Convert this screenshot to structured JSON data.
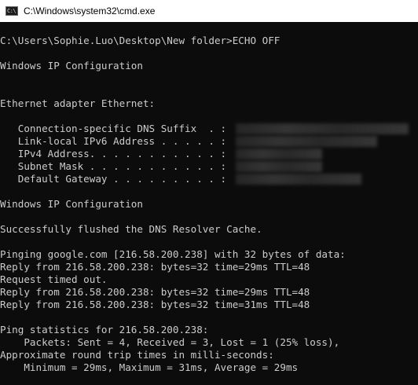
{
  "window": {
    "title": "C:\\Windows\\system32\\cmd.exe",
    "icon": "cmd-icon",
    "icon_text": "C:\\"
  },
  "console": {
    "lines": [
      {
        "text": "C:\\Users\\Sophie.Luo\\Desktop\\New folder>ECHO OFF"
      },
      {
        "text": ""
      },
      {
        "text": "Windows IP Configuration"
      },
      {
        "text": ""
      },
      {
        "text": ""
      },
      {
        "text": "Ethernet adapter Ethernet:"
      },
      {
        "text": ""
      },
      {
        "text": "   Connection-specific DNS Suffix  . : ",
        "redacted": true
      },
      {
        "text": "   Link-local IPv6 Address . . . . . : ",
        "redacted": true
      },
      {
        "text": "   IPv4 Address. . . . . . . . . . . : ",
        "redacted": true
      },
      {
        "text": "   Subnet Mask . . . . . . . . . . . : ",
        "redacted": true
      },
      {
        "text": "   Default Gateway . . . . . . . . . : ",
        "redacted": true
      },
      {
        "text": ""
      },
      {
        "text": "Windows IP Configuration"
      },
      {
        "text": ""
      },
      {
        "text": "Successfully flushed the DNS Resolver Cache."
      },
      {
        "text": ""
      },
      {
        "text": "Pinging google.com [216.58.200.238] with 32 bytes of data:"
      },
      {
        "text": "Reply from 216.58.200.238: bytes=32 time=29ms TTL=48"
      },
      {
        "text": "Request timed out."
      },
      {
        "text": "Reply from 216.58.200.238: bytes=32 time=29ms TTL=48"
      },
      {
        "text": "Reply from 216.58.200.238: bytes=32 time=31ms TTL=48"
      },
      {
        "text": ""
      },
      {
        "text": "Ping statistics for 216.58.200.238:"
      },
      {
        "text": "    Packets: Sent = 4, Received = 3, Lost = 1 (25% loss),"
      },
      {
        "text": "Approximate round trip times in milli-seconds:"
      },
      {
        "text": "    Minimum = 29ms, Maximum = 31ms, Average = 29ms"
      }
    ]
  },
  "colors": {
    "background": "#0c0c0c",
    "foreground": "#cccccc",
    "titlebar": "#ffffff"
  }
}
